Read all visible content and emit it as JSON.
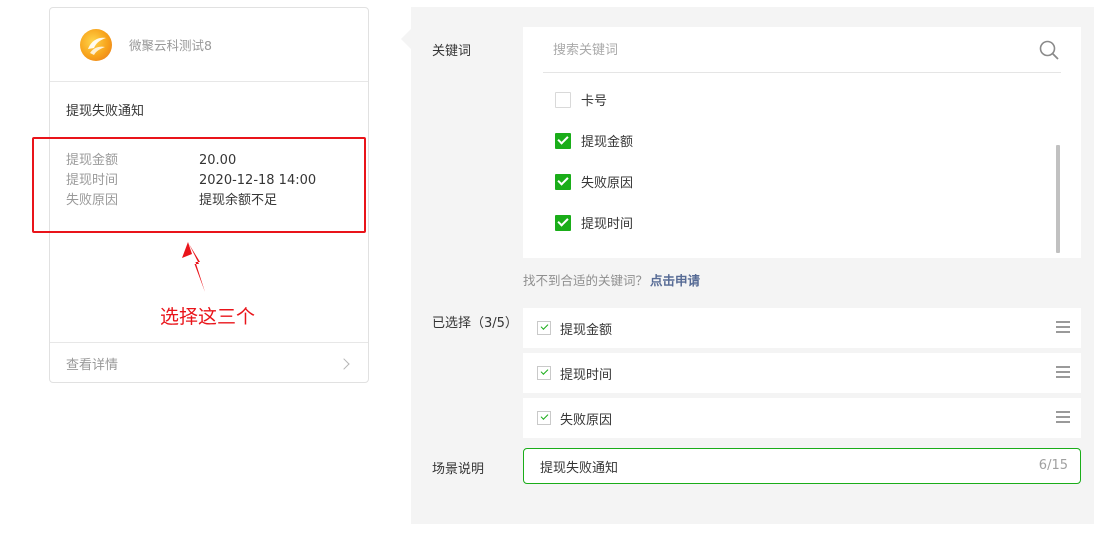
{
  "preview": {
    "brand": "微聚云科测试8",
    "title": "提现失败通知",
    "fields": [
      {
        "label": "提现金额",
        "value": "20.00"
      },
      {
        "label": "提现时间",
        "value": "2020-12-18 14:00"
      },
      {
        "label": "失败原因",
        "value": "提现余额不足"
      }
    ],
    "footer_link": "查看详情"
  },
  "annotation": {
    "note": "选择这三个",
    "color": "#e9141a"
  },
  "config": {
    "keyword_label": "关键词",
    "search_placeholder": "搜索关键词",
    "keywords": [
      {
        "label": "卡号",
        "checked": false
      },
      {
        "label": "提现金额",
        "checked": true
      },
      {
        "label": "失败原因",
        "checked": true
      },
      {
        "label": "提现时间",
        "checked": true
      }
    ],
    "hint_text": "找不到合适的关键词？",
    "hint_link": "点击申请",
    "selected_label": "已选择（3/5）",
    "selected": [
      {
        "label": "提现金额"
      },
      {
        "label": "提现时间"
      },
      {
        "label": "失败原因"
      }
    ],
    "scene_label": "场景说明",
    "scene_value": "提现失败通知",
    "scene_counter": "6/15"
  },
  "colors": {
    "accent": "#1aad19",
    "link": "#576b95",
    "panel_bg": "#f4f4f4"
  }
}
